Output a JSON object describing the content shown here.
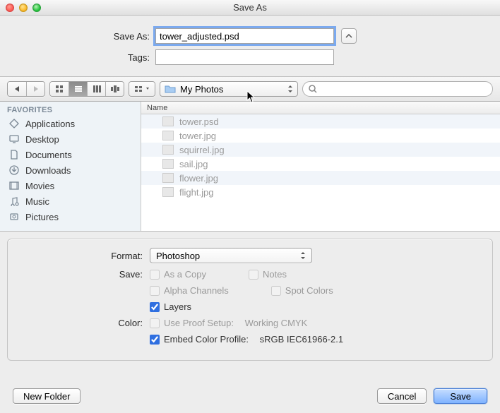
{
  "window": {
    "title": "Save As"
  },
  "form": {
    "saveas_label": "Save As:",
    "saveas_value": "tower_adjusted.psd",
    "tags_label": "Tags:",
    "tags_value": ""
  },
  "toolbar": {
    "location_folder": "My Photos",
    "search_placeholder": ""
  },
  "sidebar": {
    "header": "FAVORITES",
    "items": [
      {
        "label": "Applications",
        "icon": "app-icon"
      },
      {
        "label": "Desktop",
        "icon": "desktop-icon"
      },
      {
        "label": "Documents",
        "icon": "documents-icon"
      },
      {
        "label": "Downloads",
        "icon": "downloads-icon"
      },
      {
        "label": "Movies",
        "icon": "movies-icon"
      },
      {
        "label": "Music",
        "icon": "music-icon"
      },
      {
        "label": "Pictures",
        "icon": "pictures-icon"
      }
    ]
  },
  "files": {
    "column_header": "Name",
    "rows": [
      {
        "name": "tower.psd"
      },
      {
        "name": "tower.jpg"
      },
      {
        "name": "squirrel.jpg"
      },
      {
        "name": "sail.jpg"
      },
      {
        "name": "flower.jpg"
      },
      {
        "name": "flight.jpg"
      }
    ]
  },
  "options": {
    "format_label": "Format:",
    "format_value": "Photoshop",
    "save_label": "Save:",
    "save_checks": {
      "as_copy": "As a Copy",
      "notes": "Notes",
      "alpha": "Alpha Channels",
      "spot": "Spot Colors",
      "layers": "Layers"
    },
    "color_label": "Color:",
    "use_proof": "Use Proof Setup:",
    "proof_value": "Working CMYK",
    "embed_profile": "Embed Color Profile:",
    "profile_value": "sRGB IEC61966-2.1"
  },
  "footer": {
    "new_folder": "New Folder",
    "cancel": "Cancel",
    "save": "Save"
  }
}
